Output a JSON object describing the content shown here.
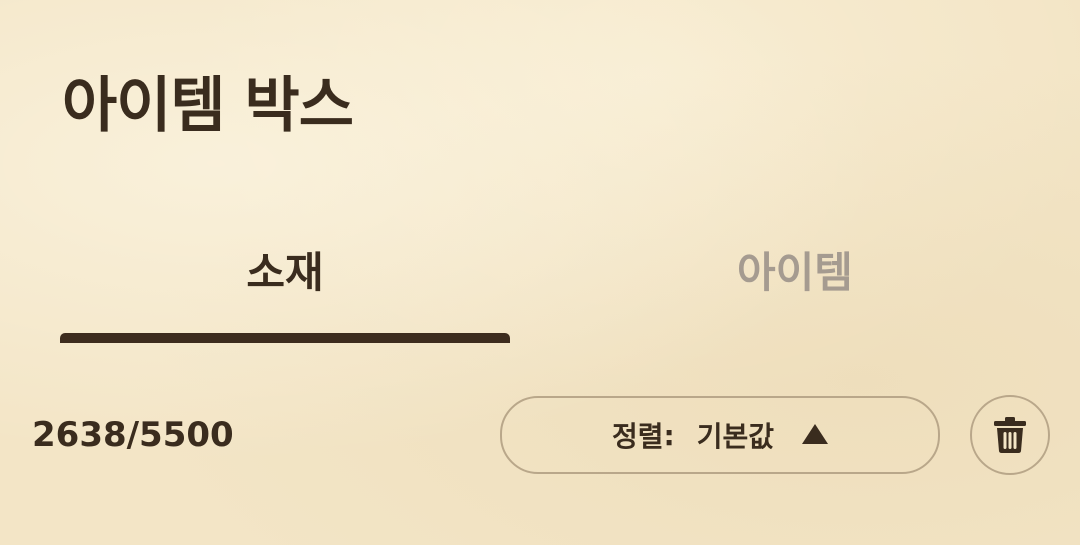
{
  "header": {
    "title": "아이템 박스"
  },
  "tabs": [
    {
      "label": "소재",
      "active": true
    },
    {
      "label": "아이템",
      "active": false
    }
  ],
  "inventory": {
    "count": "2638/5500"
  },
  "sort": {
    "label": "정렬",
    "separator": ":",
    "value": "기본값",
    "direction_icon": "triangle-up-icon"
  },
  "trash": {
    "icon": "trash-icon"
  },
  "colors": {
    "background": "#f3e5c6",
    "text_primary": "#3a2c1e",
    "text_inactive": "#a59b90",
    "border": "#b9a78a",
    "tab_indicator": "#3d2c1e"
  }
}
